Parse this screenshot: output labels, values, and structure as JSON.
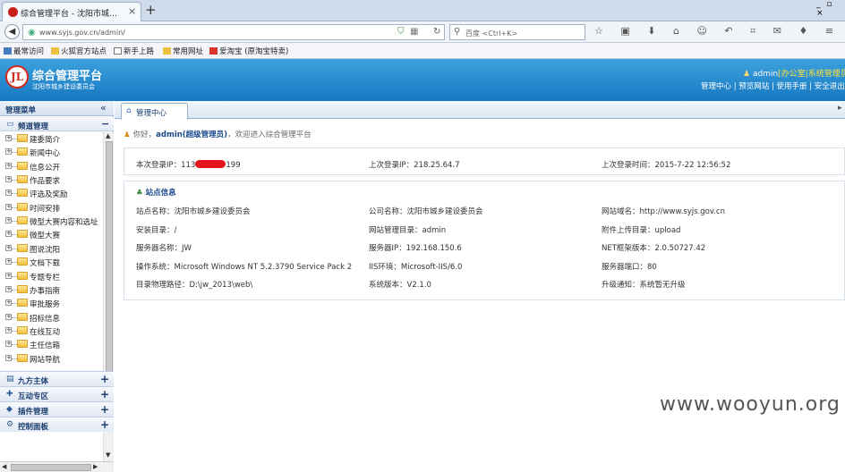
{
  "browser": {
    "tab_title": "综合管理平台 - 沈阳市城…",
    "tab_close": "×",
    "new_tab": "+",
    "window_controls": "_ ▫ ×",
    "back": "◀",
    "url": "www.syjs.gov.cn/admin/",
    "search_engine_label": "百度 <Ctrl+K>",
    "bookmarks": [
      "最常访问",
      "火狐官方站点",
      "新手上路",
      "常用网址",
      "爱淘宝 (原淘宝特卖)"
    ]
  },
  "header": {
    "logo_text": "JL",
    "title": "综合管理平台",
    "subtitle": "沈阳市城乡建设委员会",
    "user": "admin",
    "role": "[办公室|系统管理员]",
    "links": "管理中心 | 预览网站 | 使用手册 | 安全退出"
  },
  "sidebar": {
    "header": "管理菜单",
    "collapse": "«",
    "group_open": "频道管理",
    "group_open_toggle": "−",
    "items": [
      "建委简介",
      "新闻中心",
      "信息公开",
      "作品要求",
      "评选及奖励",
      "时间安排",
      "微型大赛内容和选址",
      "微型大赛",
      "图说沈阳",
      "文档下载",
      "专题专栏",
      "办事指南",
      "审批服务",
      "招标信息",
      "在线互动",
      "主任信箱",
      "网站导航"
    ],
    "groups": [
      "九方主体",
      "互动专区",
      "插件管理",
      "控制面板"
    ],
    "group_toggle": "+"
  },
  "main": {
    "tab": "管理中心",
    "greeting": "你好，",
    "user_display": "admin(超级管理员)",
    "welcome_tail": "，欢迎进入综合管理平台",
    "last_login_ip_label": "本次登录IP：",
    "last_login_ip_prefix": "113",
    "last_login_ip_suffix": "199",
    "prev_login_ip": "上次登录IP：218.25.64.7",
    "prev_login_time": "上次登录时间：2015-7-22 12:56:52",
    "site_info_title": "站点信息",
    "site_info": [
      [
        "站点名称：沈阳市城乡建设委员会",
        "公司名称：沈阳市城乡建设委员会",
        "网站域名：http://www.syjs.gov.cn"
      ],
      [
        "安装目录：/",
        "网站管理目录：admin",
        "附件上传目录：upload"
      ],
      [
        "服务器名称：JW",
        "服务器IP：192.168.150.6",
        "NET框架版本：2.0.50727.42"
      ],
      [
        "操作系统：Microsoft Windows NT 5.2.3790 Service Pack 2",
        "IIS环境：Microsoft-IIS/6.0",
        "服务器端口：80"
      ],
      [
        "目录物理路径：D:\\jw_2013\\web\\",
        "系统版本：V2.1.0",
        "升级通知：系统暂无升级"
      ]
    ]
  },
  "watermark": "www.wooyun.org"
}
